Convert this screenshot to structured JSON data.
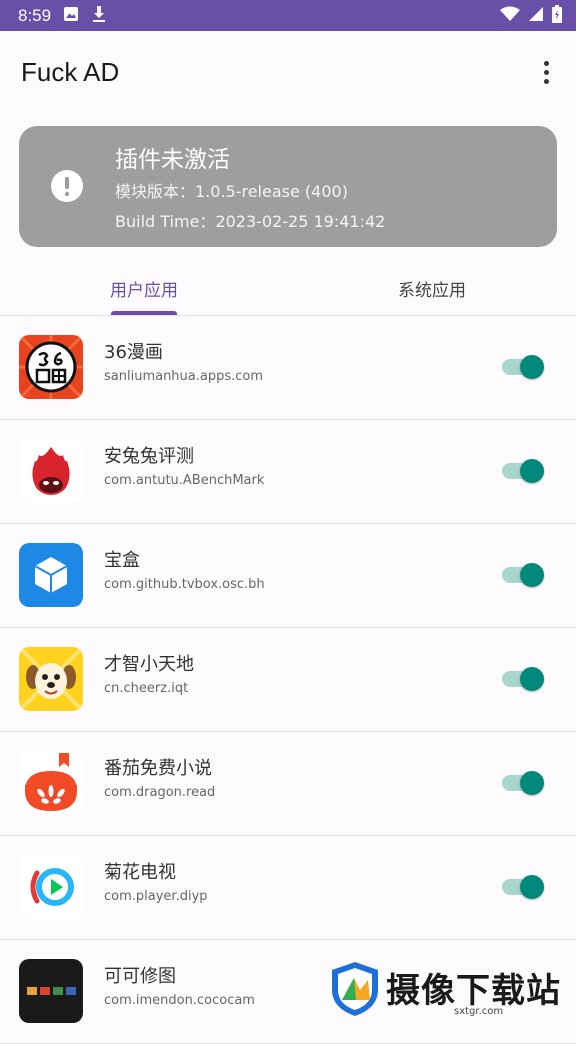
{
  "status_bar": {
    "time": "8:59"
  },
  "app_bar": {
    "title": "Fuck AD"
  },
  "status_card": {
    "title": "插件未激活",
    "module_version": "模块版本：1.0.5-release (400)",
    "build_time": "Build Time：2023-02-25 19:41:42",
    "color": "#9E9E9E"
  },
  "tabs": [
    {
      "label": "用户应用",
      "selected": true
    },
    {
      "label": "系统应用",
      "selected": false
    }
  ],
  "apps": [
    {
      "name": "36漫画",
      "package": "sanliumanhua.apps.com",
      "enabled": true
    },
    {
      "name": "安兔兔评测",
      "package": "com.antutu.ABenchMark",
      "enabled": true
    },
    {
      "name": "宝盒",
      "package": "com.github.tvbox.osc.bh",
      "enabled": true
    },
    {
      "name": "才智小天地",
      "package": "cn.cheerz.iqt",
      "enabled": true
    },
    {
      "name": "番茄免费小说",
      "package": "com.dragon.read",
      "enabled": true
    },
    {
      "name": "菊花电视",
      "package": "com.player.diyp",
      "enabled": true
    },
    {
      "name": "可可修图",
      "package": "com.imendon.cococam",
      "enabled": true
    }
  ],
  "watermark": {
    "text": "摄像下载站",
    "site": "sxtgr.com"
  },
  "colors": {
    "accent": "#6A4FA8",
    "switch_on": "#00897B",
    "status_bar": "#6A4FA8"
  }
}
